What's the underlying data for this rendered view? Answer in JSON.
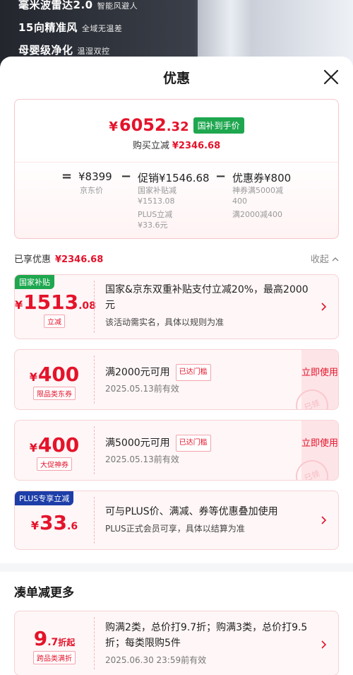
{
  "banner": {
    "lines": [
      {
        "main": "毫米波雷达2.0",
        "sub": "智能风避人"
      },
      {
        "main": "15向精准风",
        "sub": "全域无温差"
      },
      {
        "main": "母婴级净化",
        "sub": "温湿双控"
      }
    ]
  },
  "sheet": {
    "title": "优惠"
  },
  "summary": {
    "currency": "¥",
    "price_int": "6052",
    "price_dec": ".32",
    "green_tag": "国补到手价",
    "sub_label": "购买立减",
    "sub_amount": "¥2346.68",
    "eq": "=",
    "minus": "−",
    "jd_price": "¥8399",
    "jd_price_label": "京东价",
    "promo_label": "促销¥1546.68",
    "promo_detail_1": "国家补贴减",
    "promo_detail_2": "¥1513.08",
    "promo_detail_3": "PLUS立减",
    "promo_detail_4": "¥33.6元",
    "coupon_label": "优惠券¥800",
    "coupon_detail_1": "神券满5000减",
    "coupon_detail_2": "400",
    "coupon_detail_3": "满2000减400"
  },
  "enjoyed": {
    "label": "已享优惠",
    "amount": "¥2346.68",
    "collapse": "收起"
  },
  "cards": {
    "subsidy": {
      "corner": "国家补贴",
      "yen": "¥",
      "int": "1513",
      "dec": ".08",
      "tag": "立减",
      "desc": "国家&京东双重补贴支付立减20%，最高2000元",
      "desc2": "该活动需实名，具体以规则为准"
    },
    "coupon1": {
      "yen": "¥",
      "int": "400",
      "tag": "限品类东券",
      "desc": "满2000元可用",
      "reached": "已达门槛",
      "date": "2025.05.13前有效",
      "use": "立即使用",
      "stamp": "已领"
    },
    "coupon2": {
      "yen": "¥",
      "int": "400",
      "tag": "大促神券",
      "desc": "满5000元可用",
      "reached": "已达门槛",
      "date": "2025.05.13前有效",
      "use": "立即使用",
      "stamp": "已领"
    },
    "plus": {
      "corner": "PLUS专享立减",
      "yen": "¥",
      "int": "33",
      "dec": ".6",
      "desc": "可与PLUS价、满减、券等优惠叠加使用",
      "desc2": "PLUS正式会员可享，具体以结算为准"
    },
    "discount": {
      "int": "9",
      "dec": ".7",
      "unit": "折起",
      "tag": "跨品类满折",
      "desc": "购满2类，总价打9.7折；购满3类，总价打9.5折；每类限购5件",
      "date": "2025.06.30  23:59前有效"
    }
  },
  "more": {
    "title": "凑单减更多"
  },
  "colors": {
    "accent": "#e4132a",
    "green": "#1ea74f",
    "plus_blue": "#1d3ea8"
  }
}
